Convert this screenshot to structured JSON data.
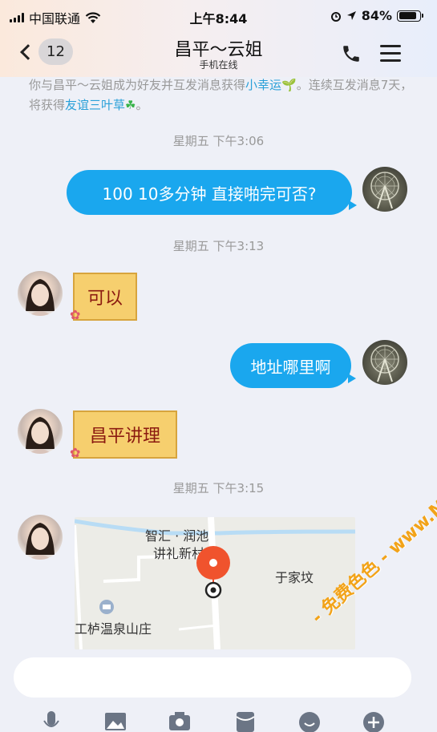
{
  "status_bar": {
    "carrier": "中国联通",
    "time": "上午8:44",
    "battery": "84%",
    "battery_level": 0.84
  },
  "nav": {
    "unread_count": "12",
    "contact_name": "昌平～云姐",
    "contact_status": "手机在线"
  },
  "notice": {
    "part1": "你与昌平～云姐成为好友并互发消息获得",
    "link1": "小幸运",
    "part2": "。连续互发消息7天，将获得",
    "link2": "友谊三叶草",
    "part3": "。"
  },
  "timestamps": [
    "星期五 下午3:06",
    "星期五 下午3:13",
    "星期五 下午3:15"
  ],
  "messages": {
    "m1": "100 10多分钟 直接啪完可否?",
    "m2": "可以",
    "m3": "地址哪里啊",
    "m4": "昌平讲理"
  },
  "map": {
    "labels": [
      "智汇 · 润池",
      "讲礼新村",
      "于家坟",
      "工栌温泉山庄"
    ]
  },
  "watermark": "- 免费色色 - www.MFsese.com",
  "colors": {
    "bubble": "#1aa7ee",
    "link": "#2aa0d8",
    "card_bg": "#f6cf6e",
    "map_pin": "#f0532d",
    "watermark": "#f2a319"
  }
}
